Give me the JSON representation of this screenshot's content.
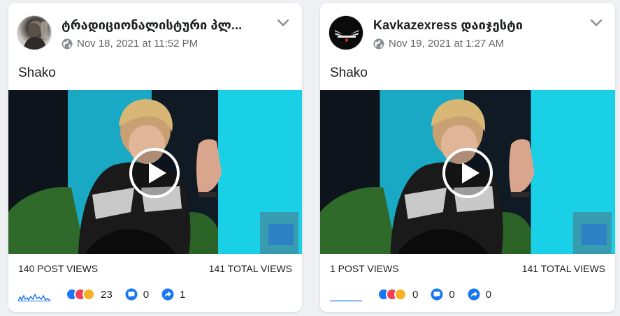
{
  "colors": {
    "accent": "#1877f2",
    "meta": "#65676b",
    "card": "#ffffff",
    "bg": "#eef0f4"
  },
  "cards": [
    {
      "page_name": "ტრადიციონალისტური პლ...",
      "timestamp": "Nov 18, 2021 at 11:52 PM",
      "post_title": "Shako",
      "post_views": "140 POST VIEWS",
      "total_views": "141 TOTAL VIEWS",
      "reactions_count": "23",
      "comments_count": "0",
      "shares_count": "1",
      "avatar_icon": "page-avatar-icon"
    },
    {
      "page_name": "Kavkazexress დაიჯესტი",
      "timestamp": "Nov 19, 2021 at 1:27 AM",
      "post_title": "Shako",
      "post_views": "1 POST VIEWS",
      "total_views": "141 TOTAL VIEWS",
      "reactions_count": "0",
      "comments_count": "0",
      "shares_count": "0",
      "avatar_icon": "kavkazexpress-logo-icon"
    }
  ]
}
